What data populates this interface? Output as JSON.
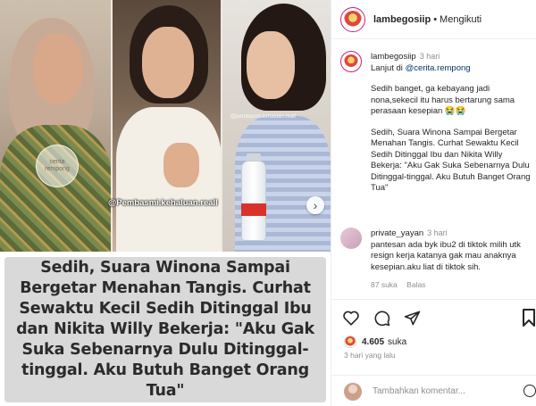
{
  "media": {
    "handle_overlay": "@Pembasmi.kehaluan.reall",
    "watermark_small": "@pembasmi.kehaluan.reall",
    "logo_text": "cerita rempong",
    "caption": "Sedih, Suara Winona Sampai Bergetar Menahan Tangis. Curhat Sewaktu Kecil Sedih Ditinggal Ibu dan Nikita Willy Bekerja: \"Aku Gak Suka Sebenarnya Dulu Ditinggal-tinggal. Aku Butuh Banget Orang Tua\""
  },
  "header": {
    "username": "lambegosiip",
    "separator": "•",
    "follow_label": "Mengikuti"
  },
  "post": {
    "username": "lambegosiip",
    "time": "3 hari",
    "continue_prefix": "Lanjut di ",
    "continue_link": "@cerita.rempong",
    "para1": "Sedih banget, ga kebayang jadi nona,sekecil itu harus bertarung sama perasaan kesepian 😭😭",
    "para2": "Sedih, Suara Winona Sampai Bergetar Menahan Tangis. Curhat Sewaktu Kecil Sedih Ditinggal Ibu dan Nikita Willy Bekerja: \"Aku Gak Suka Sebenarnya Dulu Ditinggal-tinggal. Aku Butuh Banget Orang Tua\""
  },
  "comment1": {
    "username": "private_yayan",
    "time": "3 hari",
    "text": "pantesan ada byk ibu2 di tiktok milih utk resign kerja katanya gak mau anaknya kesepian.aku liat di tiktok sih.",
    "likes": "87 suka",
    "reply": "Balas"
  },
  "actions": {
    "likes_count": "4.605",
    "likes_suffix": "suka",
    "posted_ago": "3 hari yang lalu"
  },
  "comment_input": {
    "placeholder": "Tambahkan komentar..."
  },
  "colors": {
    "story_ring": "#c9227a",
    "link": "#00376b",
    "muted": "#8e8e8e",
    "caption_bg": "#d9d9d9"
  }
}
